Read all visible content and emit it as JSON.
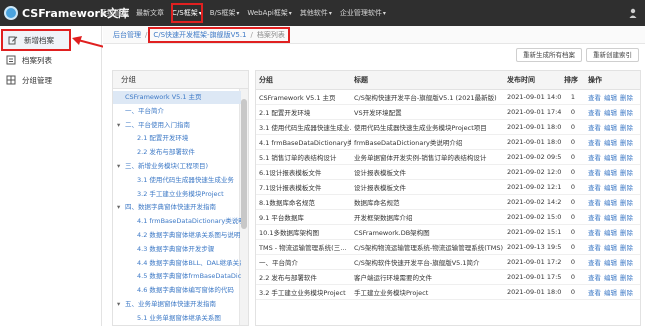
{
  "app": {
    "title": "CSFramework文库"
  },
  "nav": {
    "items": [
      {
        "label": "系统管理",
        "caret": false
      },
      {
        "label": "最新文章",
        "caret": false
      },
      {
        "label": "C/S框架",
        "caret": true
      },
      {
        "label": "B/S框架",
        "caret": true
      },
      {
        "label": "WebApi框架",
        "caret": true
      },
      {
        "label": "其他软件",
        "caret": true
      },
      {
        "label": "企业管理软件",
        "caret": true
      }
    ],
    "caret_glyph": "▾"
  },
  "sidebar": {
    "items": [
      {
        "label": "新增档案",
        "icon": "edit-icon"
      },
      {
        "label": "档案列表",
        "icon": "list-icon"
      },
      {
        "label": "分组管理",
        "icon": "group-icon"
      }
    ]
  },
  "breadcrumb": {
    "home": "后台管理",
    "sep": "/",
    "section": "C/S快速开发框架-旗舰版V5.1",
    "current": "档案列表"
  },
  "toolbar": {
    "regen_all": "重新生成所有档案",
    "regen_index": "重新创建索引"
  },
  "tree": {
    "header": "分组",
    "items": [
      {
        "label": "CSFramework V5.1 主页",
        "caret": "",
        "indent": 0,
        "selected": true
      },
      {
        "label": "一、平台简介",
        "caret": "",
        "indent": 0
      },
      {
        "label": "二、平台使用入门指南",
        "caret": "▾",
        "indent": 0
      },
      {
        "label": "2.1 配置开发环境",
        "caret": "",
        "indent": 1
      },
      {
        "label": "2.2 发布与部署软件",
        "caret": "",
        "indent": 1
      },
      {
        "label": "三、新增业务模块(工程项目)",
        "caret": "▾",
        "indent": 0
      },
      {
        "label": "3.1 使用代码生成器快速生成业务",
        "caret": "",
        "indent": 1
      },
      {
        "label": "3.2 手工建立业务模块Project",
        "caret": "",
        "indent": 1
      },
      {
        "label": "四、数据字典窗体快速开发指南",
        "caret": "▾",
        "indent": 0
      },
      {
        "label": "4.1 frmBaseDataDictionary类说明",
        "caret": "",
        "indent": 1
      },
      {
        "label": "4.2 数据字典窗体继承关系图与说明",
        "caret": "",
        "indent": 1
      },
      {
        "label": "4.3 数据字典窗体开发步骤",
        "caret": "",
        "indent": 1
      },
      {
        "label": "4.4 数据字典窗体BLL、DAL继承关系",
        "caret": "",
        "indent": 1
      },
      {
        "label": "4.5 数据字典窗体frmBaseDataDictionary",
        "caret": "",
        "indent": 1
      },
      {
        "label": "4.6 数据字典窗体编写窗体的代码",
        "caret": "",
        "indent": 1
      },
      {
        "label": "五、业务单据窗体快速开发指南",
        "caret": "▾",
        "indent": 0
      },
      {
        "label": "5.1 业务单据窗体继承关系图",
        "caret": "",
        "indent": 1
      }
    ]
  },
  "table": {
    "columns": [
      "分组",
      "标题",
      "发布时间",
      "排序",
      "操作"
    ],
    "rows": [
      {
        "group": "CSFramework V5.1 主页",
        "title": "C/S架构快速开发平台-旗舰版V5.1 (2021最新版)",
        "time": "2021-09-01 14:04",
        "order": "1",
        "ops": [
          "查看",
          "编辑",
          "删除"
        ]
      },
      {
        "group": "2.1 配置开发环境",
        "title": "VS开发环境配置",
        "time": "2021-09-01 17:42",
        "order": "0",
        "ops": [
          "查看",
          "编辑",
          "删除"
        ]
      },
      {
        "group": "3.1 使用代码生成器快速生成业…",
        "title": "使用代码生成器快速生成业务模块Project项目",
        "time": "2021-09-01 18:04",
        "order": "0",
        "ops": [
          "查看",
          "编辑",
          "删除"
        ]
      },
      {
        "group": "4.1 frmBaseDataDictionary类说明",
        "title": "frmBaseDataDictionary类说明介绍",
        "time": "2021-09-01 18:08",
        "order": "0",
        "ops": [
          "查看",
          "编辑",
          "删除"
        ]
      },
      {
        "group": "5.1 销售订单的表结构设计",
        "title": "业务单据窗体开发实例-销售订单的表结构设计",
        "time": "2021-09-02 09:52",
        "order": "0",
        "ops": [
          "查看",
          "编辑",
          "删除"
        ]
      },
      {
        "group": "6.1设计报表模板文件",
        "title": "设计报表模板文件",
        "time": "2021-09-02 12:07",
        "order": "0",
        "ops": [
          "查看",
          "编辑",
          "删除"
        ]
      },
      {
        "group": "7.1设计报表模板文件",
        "title": "设计报表模板文件",
        "time": "2021-09-02 12:16",
        "order": "0",
        "ops": [
          "查看",
          "编辑",
          "删除"
        ]
      },
      {
        "group": "8.1数据库命名规范",
        "title": "数据库命名规范",
        "time": "2021-09-02 14:28",
        "order": "0",
        "ops": [
          "查看",
          "编辑",
          "删除"
        ]
      },
      {
        "group": "9.1 平台数据库",
        "title": "开发框架数据库介绍",
        "time": "2021-09-02 15:09",
        "order": "0",
        "ops": [
          "查看",
          "编辑",
          "删除"
        ]
      },
      {
        "group": "10.1多数据库架构图",
        "title": "CSFramework.DB架构图",
        "time": "2021-09-02 15:11",
        "order": "0",
        "ops": [
          "查看",
          "编辑",
          "删除"
        ]
      },
      {
        "group": "TMS - 物流运输管理系统(三…",
        "title": "C/S架构物流运输管理系统-物流运输管理系统(TMS)",
        "time": "2021-09-13 19:50",
        "order": "0",
        "ops": [
          "查看",
          "编辑",
          "删除"
        ]
      },
      {
        "group": "一、平台简介",
        "title": "C/S架构软件快速开发平台-旗舰版V5.1简介",
        "time": "2021-09-01 17:23",
        "order": "0",
        "ops": [
          "查看",
          "编辑",
          "删除"
        ]
      },
      {
        "group": "2.2 发布与部署软件",
        "title": "客户端运行环境需要的文件",
        "time": "2021-09-01 17:59",
        "order": "0",
        "ops": [
          "查看",
          "编辑",
          "删除"
        ]
      },
      {
        "group": "3.2 手工建立业务模块Project",
        "title": "手工建立业务模块Project",
        "time": "2021-09-01 18:05",
        "order": "0",
        "ops": [
          "查看",
          "编辑",
          "删除"
        ]
      }
    ]
  },
  "colors": {
    "navbar": "#2f2f2f",
    "link": "#3d79c6",
    "highlight": "#e02020"
  }
}
